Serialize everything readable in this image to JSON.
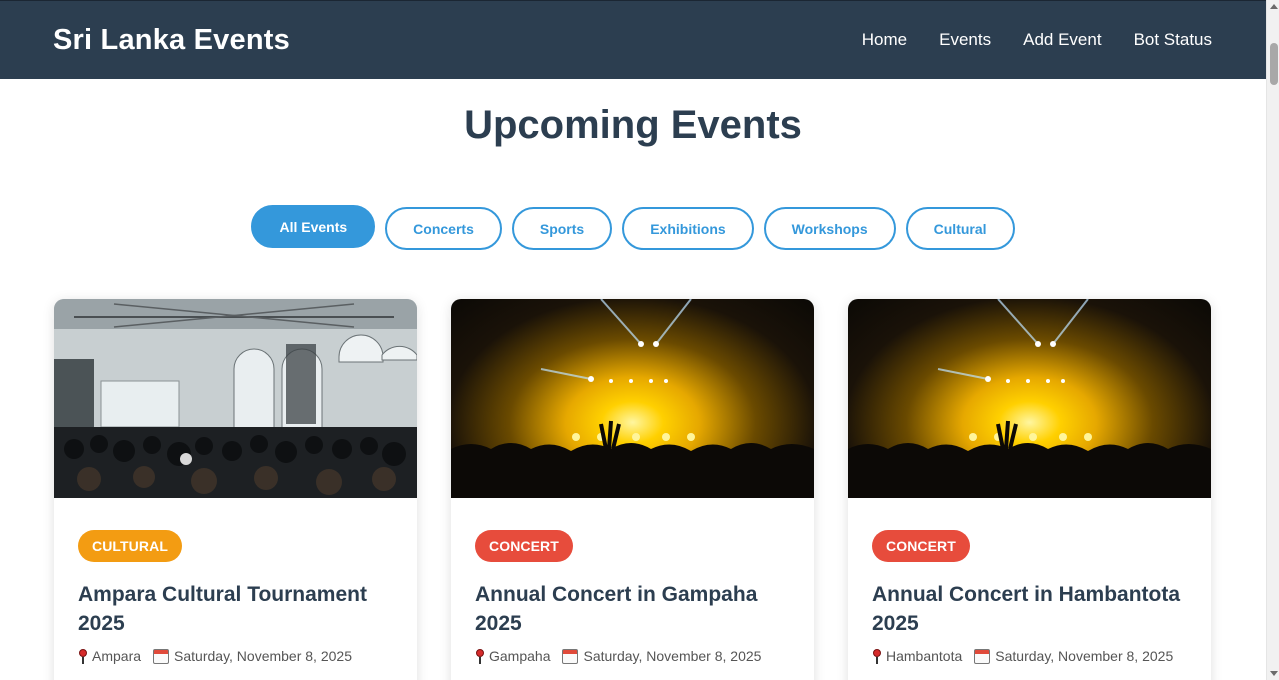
{
  "header": {
    "brand": "Sri Lanka Events",
    "nav": [
      "Home",
      "Events",
      "Add Event",
      "Bot Status"
    ]
  },
  "main": {
    "title": "Upcoming Events",
    "filters": [
      {
        "label": "All Events",
        "active": true
      },
      {
        "label": "Concerts",
        "active": false
      },
      {
        "label": "Sports",
        "active": false
      },
      {
        "label": "Exhibitions",
        "active": false
      },
      {
        "label": "Workshops",
        "active": false
      },
      {
        "label": "Cultural",
        "active": false
      }
    ],
    "events": [
      {
        "category": "CULTURAL",
        "category_color": "#f39c12",
        "title": "Ampara Cultural Tournament 2025",
        "location": "Ampara",
        "date": "Saturday, November 8, 2025",
        "image": "conference-hall-photo"
      },
      {
        "category": "CONCERT",
        "category_color": "#e74c3c",
        "title": "Annual Concert in Gampaha 2025",
        "location": "Gampaha",
        "date": "Saturday, November 8, 2025",
        "image": "concert-crowd-photo"
      },
      {
        "category": "CONCERT",
        "category_color": "#e74c3c",
        "title": "Annual Concert in Hambantota 2025",
        "location": "Hambantota",
        "date": "Saturday, November 8, 2025",
        "image": "concert-crowd-photo"
      }
    ]
  },
  "colors": {
    "header_bg": "#2c3e50",
    "accent": "#3498db",
    "text_dark": "#2c3e50"
  }
}
